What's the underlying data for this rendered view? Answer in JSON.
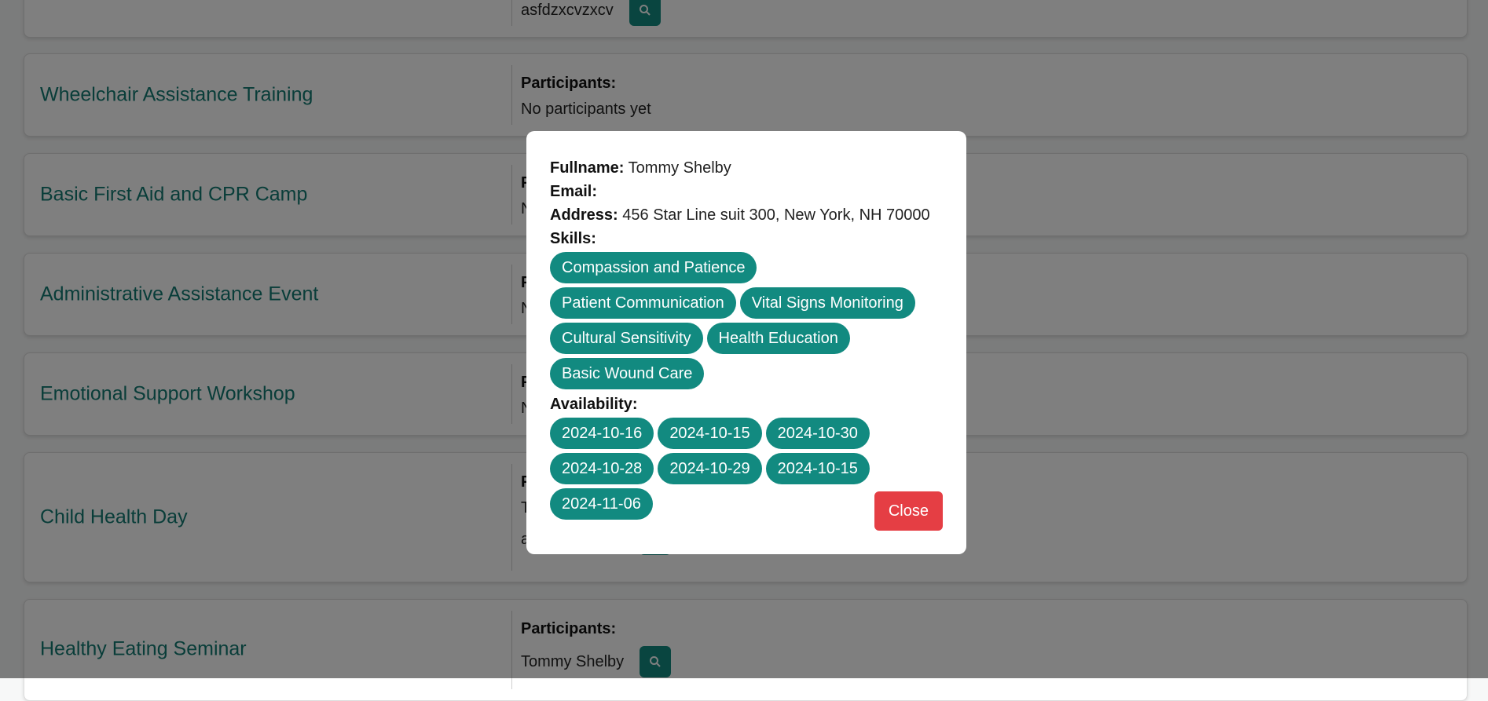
{
  "events": [
    {
      "title": "",
      "participants_label": "",
      "participants_text": "asfdzxcvzxcv",
      "has_search": true
    },
    {
      "title": "Wheelchair Assistance Training",
      "participants_label": "Participants:",
      "participants_text": "No participants yet",
      "has_search": false
    },
    {
      "title": "Basic First Aid and CPR Camp",
      "participants_label": "P",
      "participants_text": "N",
      "has_search": false
    },
    {
      "title": "Administrative Assistance Event",
      "participants_label": "P",
      "participants_text": "N",
      "has_search": false
    },
    {
      "title": "Emotional Support Workshop",
      "participants_label": "P",
      "participants_text": "N",
      "has_search": false
    },
    {
      "title": "Child Health Day",
      "participants_label": "P",
      "participants_text": "T",
      "participants_text2": "a",
      "has_search": true
    },
    {
      "title": "Healthy Eating Seminar",
      "participants_label": "Participants:",
      "participants_text": "Tommy Shelby",
      "has_search": true
    }
  ],
  "modal": {
    "fullname_label": "Fullname:",
    "fullname": "Tommy Shelby",
    "email_label": "Email:",
    "email": "",
    "address_label": "Address:",
    "address": "456 Star Line suit 300, New York, NH 70000",
    "skills_label": "Skills:",
    "skills": [
      "Compassion and Patience",
      "Patient Communication",
      "Vital Signs Monitoring",
      "Cultural Sensitivity",
      "Health Education",
      "Basic Wound Care"
    ],
    "availability_label": "Availability:",
    "availability": [
      "2024-10-16",
      "2024-10-15",
      "2024-10-30",
      "2024-10-28",
      "2024-10-29",
      "2024-10-15",
      "2024-11-06"
    ],
    "close_label": "Close"
  },
  "colors": {
    "accent": "#128a80",
    "danger": "#e53e44",
    "title": "#137a72"
  }
}
